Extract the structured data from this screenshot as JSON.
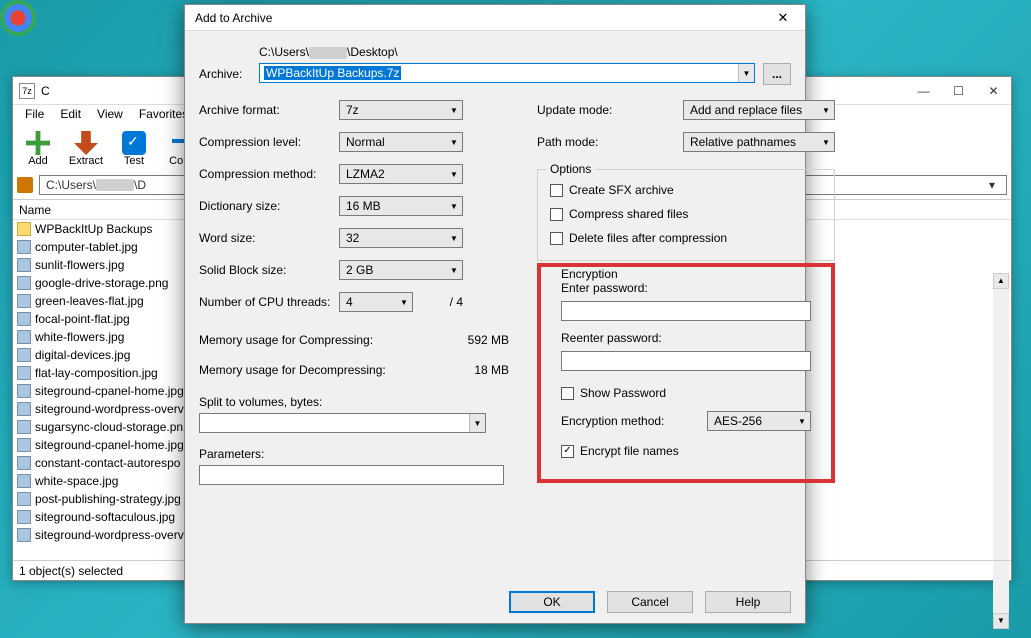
{
  "dialog": {
    "title": "Add to Archive",
    "archive_label": "Archive:",
    "archive_path": "C:\\Users\\",
    "archive_path_after": "\\Desktop\\",
    "archive_filename": "WPBackItUp Backups.7z",
    "browse": "...",
    "left": {
      "format_label": "Archive format:",
      "format_value": "7z",
      "level_label": "Compression level:",
      "level_value": "Normal",
      "method_label": "Compression method:",
      "method_value": "LZMA2",
      "dict_label": "Dictionary size:",
      "dict_value": "16 MB",
      "word_label": "Word size:",
      "word_value": "32",
      "block_label": "Solid Block size:",
      "block_value": "2 GB",
      "threads_label": "Number of CPU threads:",
      "threads_value": "4",
      "threads_max": "/ 4",
      "mem_comp_label": "Memory usage for Compressing:",
      "mem_comp_value": "592 MB",
      "mem_decomp_label": "Memory usage for Decompressing:",
      "mem_decomp_value": "18 MB",
      "volumes_label": "Split to volumes, bytes:",
      "params_label": "Parameters:"
    },
    "right": {
      "update_label": "Update mode:",
      "update_value": "Add and replace files",
      "path_label": "Path mode:",
      "path_value": "Relative pathnames",
      "options_title": "Options",
      "opt_sfx": "Create SFX archive",
      "opt_shared": "Compress shared files",
      "opt_delete": "Delete files after compression",
      "enc_title": "Encryption",
      "enc_enter": "Enter password:",
      "enc_reenter": "Reenter password:",
      "enc_show": "Show Password",
      "enc_method_label": "Encryption method:",
      "enc_method_value": "AES-256",
      "enc_names": "Encrypt file names"
    },
    "buttons": {
      "ok": "OK",
      "cancel": "Cancel",
      "help": "Help"
    }
  },
  "sevenZip": {
    "title": "C",
    "menubar": [
      "File",
      "Edit",
      "View",
      "Favorites"
    ],
    "toolbar": [
      {
        "label": "Add",
        "icon": "add"
      },
      {
        "label": "Extract",
        "icon": "extract"
      },
      {
        "label": "Test",
        "icon": "test"
      },
      {
        "label": "Copy",
        "icon": "copy"
      }
    ],
    "address": "C:\\Users\\",
    "address_after": "\\D",
    "list_header": "Name",
    "files": [
      {
        "name": "WPBackItUp Backups",
        "type": "folder"
      },
      {
        "name": "computer-tablet.jpg",
        "type": "file"
      },
      {
        "name": "sunlit-flowers.jpg",
        "type": "file"
      },
      {
        "name": "google-drive-storage.png",
        "type": "file"
      },
      {
        "name": "green-leaves-flat.jpg",
        "type": "file"
      },
      {
        "name": "focal-point-flat.jpg",
        "type": "file"
      },
      {
        "name": "white-flowers.jpg",
        "type": "file"
      },
      {
        "name": "digital-devices.jpg",
        "type": "file"
      },
      {
        "name": "flat-lay-composition.jpg",
        "type": "file"
      },
      {
        "name": "siteground-cpanel-home.jpg",
        "type": "file"
      },
      {
        "name": "siteground-wordpress-overv",
        "type": "file"
      },
      {
        "name": "sugarsync-cloud-storage.pn",
        "type": "file"
      },
      {
        "name": "siteground-cpanel-home.jpg",
        "type": "file"
      },
      {
        "name": "constant-contact-autorespo",
        "type": "file"
      },
      {
        "name": "white-space.jpg",
        "type": "file"
      },
      {
        "name": "post-publishing-strategy.jpg",
        "type": "file"
      },
      {
        "name": "siteground-softaculous.jpg",
        "type": "file"
      },
      {
        "name": "siteground-wordpress-overv",
        "type": "file"
      }
    ],
    "status": "1 object(s) selected",
    "win_controls": {
      "min": "—",
      "max": "☐",
      "close": "✕"
    }
  }
}
